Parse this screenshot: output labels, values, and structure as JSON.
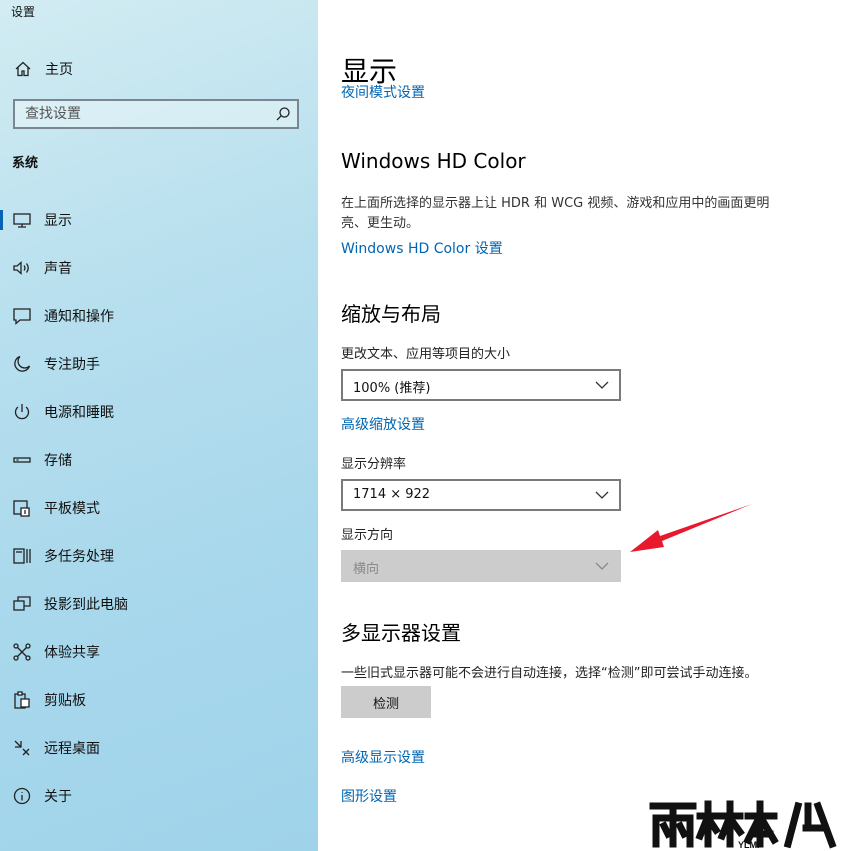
{
  "window": {
    "title": "设置"
  },
  "sidebar": {
    "home_label": "主页",
    "search_placeholder": "查找设置",
    "section_label": "系统",
    "items": [
      {
        "label": "显示",
        "icon": "monitor-icon",
        "active": true
      },
      {
        "label": "声音",
        "icon": "speaker-icon"
      },
      {
        "label": "通知和操作",
        "icon": "notification-icon"
      },
      {
        "label": "专注助手",
        "icon": "moon-icon"
      },
      {
        "label": "电源和睡眠",
        "icon": "power-icon"
      },
      {
        "label": "存储",
        "icon": "storage-icon"
      },
      {
        "label": "平板模式",
        "icon": "tablet-icon"
      },
      {
        "label": "多任务处理",
        "icon": "multitask-icon"
      },
      {
        "label": "投影到此电脑",
        "icon": "project-icon"
      },
      {
        "label": "体验共享",
        "icon": "share-icon"
      },
      {
        "label": "剪贴板",
        "icon": "clipboard-icon"
      },
      {
        "label": "远程桌面",
        "icon": "remote-icon"
      },
      {
        "label": "关于",
        "icon": "info-icon"
      }
    ]
  },
  "main": {
    "title": "显示",
    "night_link": "夜间模式设置",
    "hdr": {
      "heading": "Windows HD Color",
      "description": "在上面所选择的显示器上让 HDR 和 WCG 视频、游戏和应用中的画面更明亮、更生动。",
      "link": "Windows HD Color 设置"
    },
    "scale": {
      "heading": "缩放与布局",
      "size_label": "更改文本、应用等项目的大小",
      "size_value": "100% (推荐)",
      "advanced_link": "高级缩放设置",
      "resolution_label": "显示分辨率",
      "resolution_value": "1714 × 922",
      "orientation_label": "显示方向",
      "orientation_value": "横向"
    },
    "multi": {
      "heading": "多显示器设置",
      "description": "一些旧式显示器可能不会进行自动连接，选择“检测”即可尝试手动连接。",
      "detect_button": "检测",
      "advanced_display_link": "高级显示设置",
      "graphics_link": "图形设置"
    }
  },
  "overlay": {
    "arrow_color": "#e8192c",
    "watermark_logo": "ylmf-logo"
  }
}
